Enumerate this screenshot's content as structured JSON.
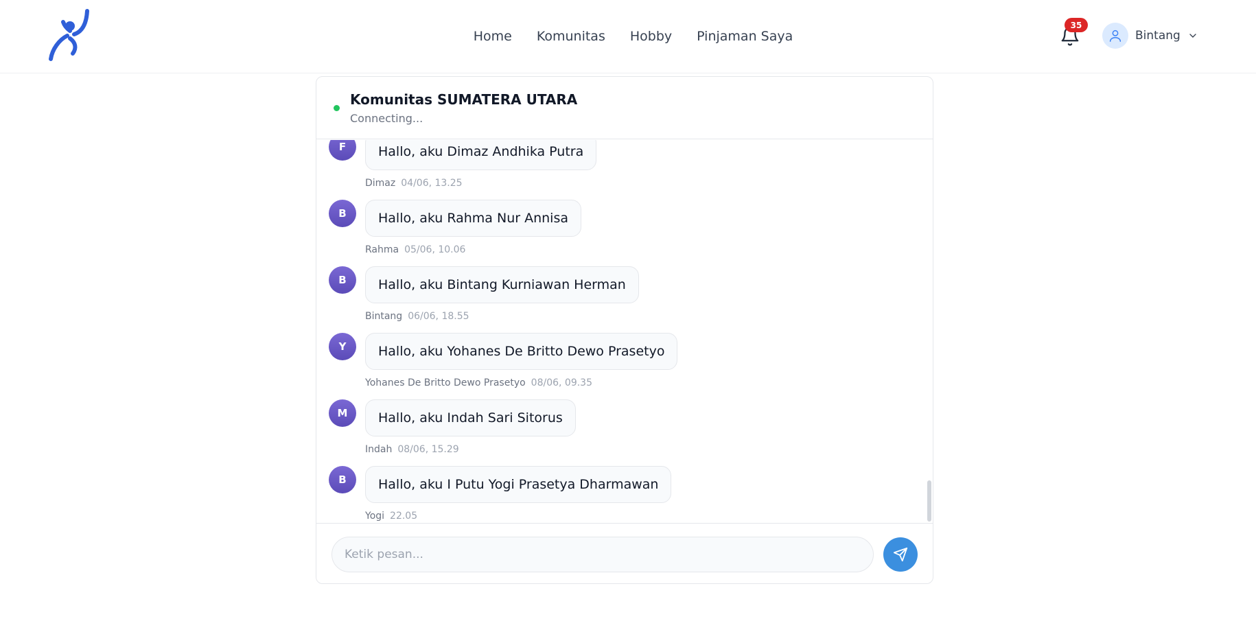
{
  "header": {
    "nav": [
      "Home",
      "Komunitas",
      "Hobby",
      "Pinjaman Saya"
    ],
    "notification_count": "35",
    "user_name": "Bintang"
  },
  "chat": {
    "title": "Komunitas SUMATERA UTARA",
    "status": "Connecting...",
    "status_color": "#22c55e",
    "input_placeholder": "Ketik pesan...",
    "messages": [
      {
        "initial": "F",
        "text": "Hallo, aku Dimaz Andhika Putra",
        "sender": "Dimaz",
        "time": "04/06, 13.25"
      },
      {
        "initial": "B",
        "text": "Hallo, aku Rahma Nur Annisa",
        "sender": "Rahma",
        "time": "05/06, 10.06"
      },
      {
        "initial": "B",
        "text": "Hallo, aku Bintang Kurniawan Herman",
        "sender": "Bintang",
        "time": "06/06, 18.55"
      },
      {
        "initial": "Y",
        "text": "Hallo, aku Yohanes De Britto Dewo Prasetyo",
        "sender": "Yohanes De Britto Dewo Prasetyo",
        "time": "08/06, 09.35"
      },
      {
        "initial": "M",
        "text": "Hallo, aku Indah Sari Sitorus",
        "sender": "Indah",
        "time": "08/06, 15.29"
      },
      {
        "initial": "B",
        "text": "Hallo, aku I Putu Yogi Prasetya Dharmawan",
        "sender": "Yogi",
        "time": "22.05"
      }
    ]
  },
  "colors": {
    "accent": "#3b8fdf",
    "logo": "#2f5fd8",
    "badge": "#dc2626",
    "avatar": "#6b5ac8"
  }
}
